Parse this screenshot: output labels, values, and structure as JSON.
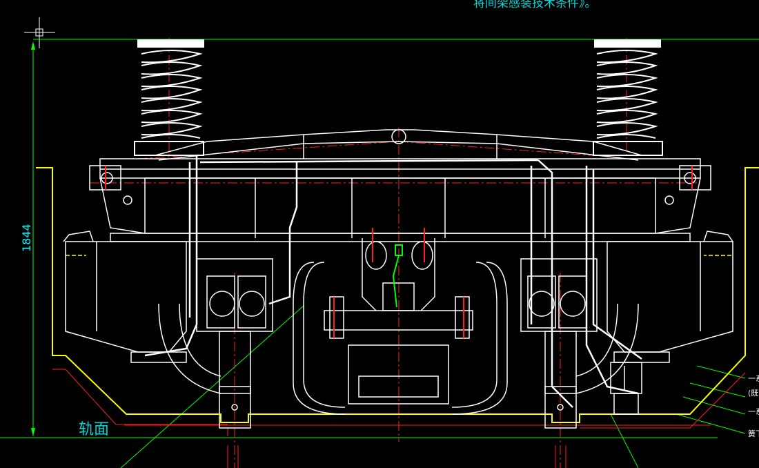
{
  "header": {
    "note_text": "将间架感装技术条件》。"
  },
  "dimensions": {
    "height_value": "1844"
  },
  "labels": {
    "rail_surface": "轨面"
  },
  "callouts": [
    {
      "text": "一系"
    },
    {
      "text": "(既"
    },
    {
      "text": "一系"
    },
    {
      "text": "簧下"
    }
  ],
  "colors": {
    "background": "#000000",
    "linework": "#ffffff",
    "centerline": "#ff2020",
    "envelope": "#ffff00",
    "dimension": "#00ff00",
    "text_cyan": "#00d7d7"
  }
}
